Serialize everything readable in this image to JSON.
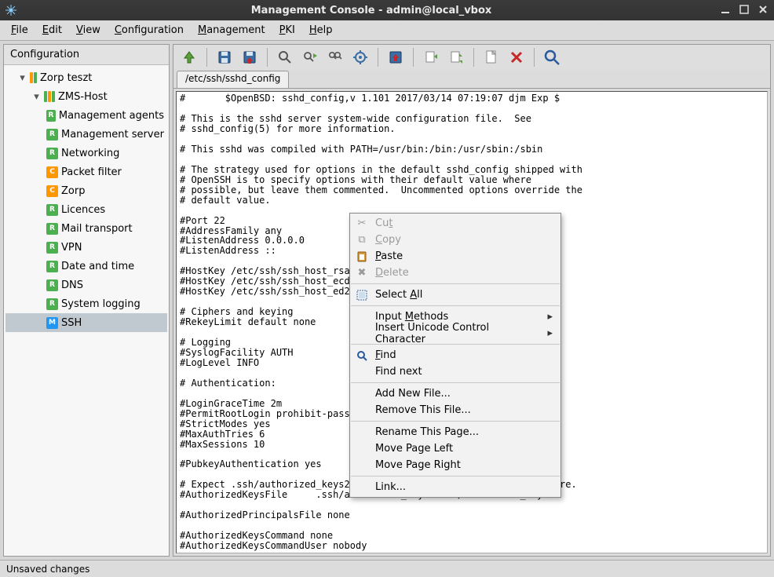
{
  "window": {
    "title": "Management Console - admin@local_vbox"
  },
  "menubar": [
    "File",
    "Edit",
    "View",
    "Configuration",
    "Management",
    "PKI",
    "Help"
  ],
  "sidebar": {
    "header": "Configuration",
    "root": {
      "label": "Zorp teszt"
    },
    "host": {
      "label": "ZMS-Host"
    },
    "items": [
      {
        "badge": "R",
        "label": "Management agents"
      },
      {
        "badge": "R",
        "label": "Management server"
      },
      {
        "badge": "R",
        "label": "Networking"
      },
      {
        "badge": "C",
        "label": "Packet filter"
      },
      {
        "badge": "C",
        "label": "Zorp"
      },
      {
        "badge": "R",
        "label": "Licences"
      },
      {
        "badge": "R",
        "label": "Mail transport"
      },
      {
        "badge": "R",
        "label": "VPN"
      },
      {
        "badge": "R",
        "label": "Date and time"
      },
      {
        "badge": "R",
        "label": "DNS"
      },
      {
        "badge": "R",
        "label": "System logging"
      },
      {
        "badge": "M",
        "label": "SSH"
      }
    ],
    "selected": 11
  },
  "tab": {
    "label": "/etc/ssh/sshd_config"
  },
  "editor_text": "#       $OpenBSD: sshd_config,v 1.101 2017/03/14 07:19:07 djm Exp $\n\n# This is the sshd server system-wide configuration file.  See\n# sshd_config(5) for more information.\n\n# This sshd was compiled with PATH=/usr/bin:/bin:/usr/sbin:/sbin\n\n# The strategy used for options in the default sshd_config shipped with\n# OpenSSH is to specify options with their default value where\n# possible, but leave them commented.  Uncommented options override the\n# default value.\n\n#Port 22\n#AddressFamily any\n#ListenAddress 0.0.0.0\n#ListenAddress ::\n\n#HostKey /etc/ssh/ssh_host_rsa_key\n#HostKey /etc/ssh/ssh_host_ecdsa_key\n#HostKey /etc/ssh/ssh_host_ed25519_key\n\n# Ciphers and keying\n#RekeyLimit default none\n\n# Logging\n#SyslogFacility AUTH\n#LogLevel INFO\n\n# Authentication:\n\n#LoginGraceTime 2m\n#PermitRootLogin prohibit-password\n#StrictModes yes\n#MaxAuthTries 6\n#MaxSessions 10\n\n#PubkeyAuthentication yes\n\n# Expect .ssh/authorized_keys2 to be disregarded by default in future.\n#AuthorizedKeysFile     .ssh/authorized_keys .ssh/authorized_keys2\n\n#AuthorizedPrincipalsFile none\n\n#AuthorizedKeysCommand none\n#AuthorizedKeysCommandUser nobody",
  "context_menu": {
    "cut": "Cut",
    "copy": "Copy",
    "paste": "Paste",
    "delete": "Delete",
    "select_all": "Select All",
    "input_methods": "Input Methods",
    "insert_unicode": "Insert Unicode Control Character",
    "find": "Find",
    "find_next": "Find next",
    "add_new_file": "Add New File...",
    "remove_file": "Remove This File...",
    "rename_page": "Rename This Page...",
    "move_left": "Move Page Left",
    "move_right": "Move Page Right",
    "link": "Link..."
  },
  "toolbar_icons": [
    "up",
    "save",
    "save-config",
    "search",
    "find-next",
    "find-all",
    "settings",
    "import",
    "export-left",
    "export-right",
    "document",
    "delete-config",
    "big-search"
  ],
  "status": "Unsaved changes"
}
